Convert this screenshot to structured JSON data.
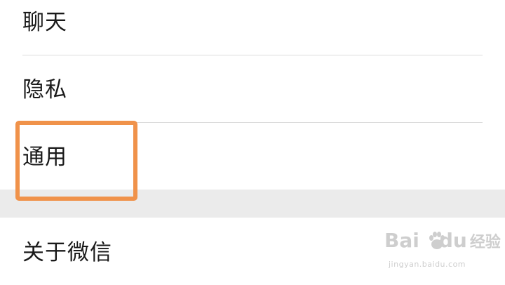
{
  "settings": {
    "items": [
      {
        "label": "聊天"
      },
      {
        "label": "隐私"
      },
      {
        "label": "通用"
      }
    ],
    "about": {
      "label": "关于微信"
    }
  },
  "highlight": {
    "target": "通用",
    "color": "#f0924a"
  },
  "watermark": {
    "logo_left": "Bai",
    "logo_right": "du",
    "logo_cn": "经验",
    "url": "jingyan.baidu.com"
  }
}
